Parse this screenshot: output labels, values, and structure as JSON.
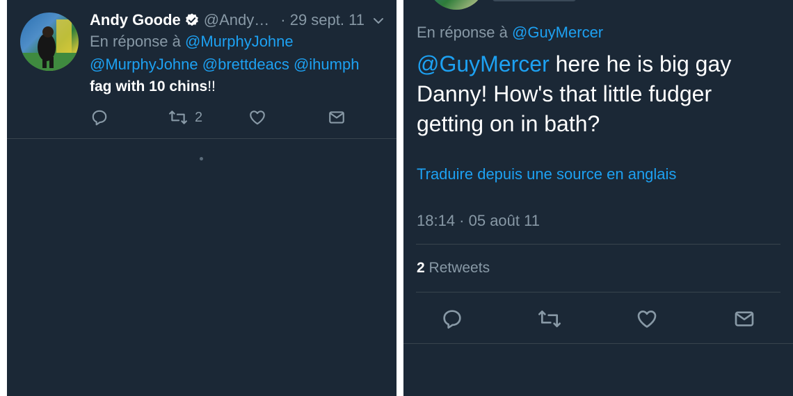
{
  "left_tweet": {
    "display_name": "Andy Goode",
    "handle": "@Andy…",
    "separator_date": "· 29 sept. 11",
    "reply_prefix": "En réponse à",
    "reply_to": "@MurphyJohne",
    "mention_1": "@MurphyJohne",
    "mention_2": "@brettdeacs",
    "mention_3": "@ihumph",
    "body_bold": "fag with 10 chins",
    "body_tail": "!!",
    "retweet_count": "2",
    "icons": [
      "reply-icon",
      "retweet-icon",
      "like-icon",
      "share-icon",
      "verified-icon",
      "chevron-down-icon"
    ]
  },
  "right_tweet": {
    "reply_prefix": "En réponse à",
    "reply_to": "@GuyMercer",
    "body_mention": "@GuyMercer",
    "body_line1_rest": " here he is big gay",
    "body_line2": "Danny! How's that little fudger",
    "body_line3": "getting on in bath?",
    "translate_link": "Traduire depuis une source en anglais",
    "timestamp": "18:14 · 05 août 11",
    "retweet_count": "2",
    "retweet_label": "Retweets",
    "icons": [
      "reply-icon",
      "retweet-icon",
      "like-icon",
      "share-icon"
    ]
  },
  "colors": {
    "background": "#1b2836",
    "accent": "#1da1f2",
    "muted": "#8899a6",
    "divider": "#38444d",
    "gutter": "#ffffff"
  }
}
